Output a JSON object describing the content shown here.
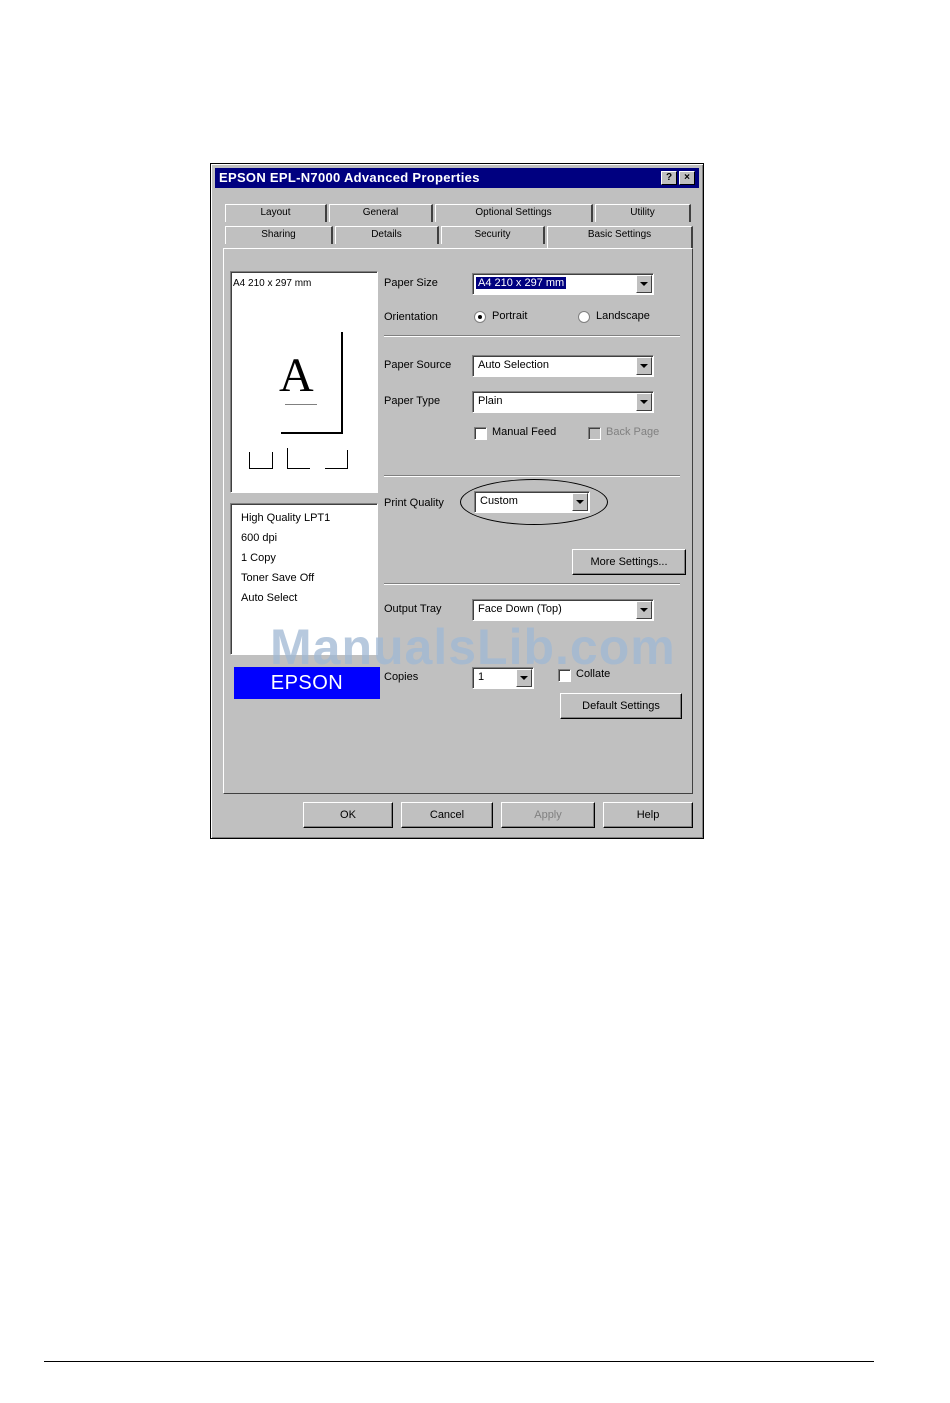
{
  "window": {
    "title": "EPSON EPL-N7000 Advanced Properties",
    "help_button": "?",
    "close_button": "×"
  },
  "tabs_back": [
    "Layout",
    "General",
    "Optional Settings",
    "Utility"
  ],
  "tabs_front": [
    "Sharing",
    "Details",
    "Security",
    "Basic Settings"
  ],
  "active_tab": "Basic Settings",
  "preview": {
    "size_text": "A4 210 x 297 mm",
    "letter": "A"
  },
  "summary": {
    "lines": [
      "High Quality LPT1",
      "600 dpi",
      "1 Copy",
      "Toner Save Off",
      "Auto Select"
    ]
  },
  "brand": "EPSON",
  "form": {
    "paper_size": {
      "label": "Paper Size",
      "value": "A4 210 x 297 mm"
    },
    "orientation": {
      "label": "Orientation",
      "portrait": "Portrait",
      "landscape": "Landscape"
    },
    "paper_source": {
      "label": "Paper Source",
      "value": "Auto Selection"
    },
    "paper_type": {
      "label": "Paper Type",
      "value": "Plain"
    },
    "manual_feed": "Manual Feed",
    "back_page": "Back Page",
    "print_quality": {
      "label": "Print Quality",
      "value": "Custom"
    },
    "more_settings": "More Settings...",
    "duplex": {
      "label": "Output Tray",
      "value": "Face Down (Top)"
    },
    "copies": {
      "label": "Copies",
      "value": "1"
    },
    "collate": "Collate",
    "default_button": "Default Settings"
  },
  "buttons": {
    "ok": "OK",
    "cancel": "Cancel",
    "apply": "Apply",
    "help": "Help"
  },
  "watermark": "ManualsLib.com",
  "colors": {
    "titlebar": "#000080",
    "face": "#c0c0c0",
    "brand": "#0000ff"
  }
}
